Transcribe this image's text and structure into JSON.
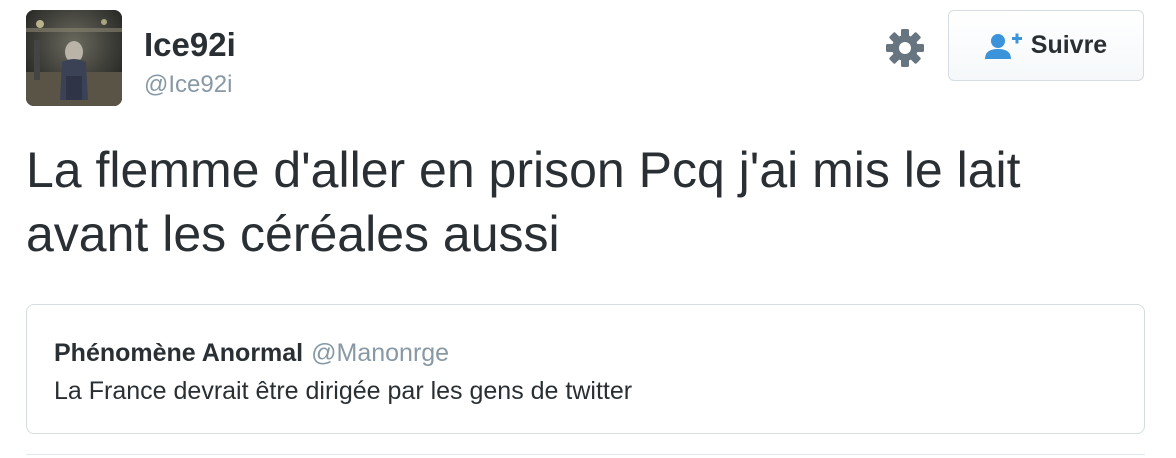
{
  "author": {
    "display_name": "Ice92i",
    "username": "@Ice92i",
    "avatar": "user-avatar-photo"
  },
  "actions": {
    "settings_icon": "gear-icon",
    "follow_icon": "user-plus-icon",
    "follow_label": "Suivre"
  },
  "tweet": {
    "text": "La flemme d'aller en prison Pcq j'ai mis le lait avant les céréales aussi"
  },
  "quoted_tweet": {
    "display_name": "Phénomène Anormal",
    "username": "@Manonrge",
    "text": "La France devrait être dirigée par les gens de twitter"
  },
  "colors": {
    "text_primary": "#292f33",
    "text_secondary": "#8899a6",
    "follow_icon": "#3b94d9",
    "gear": "#66757f",
    "border": "#d5dde2"
  }
}
